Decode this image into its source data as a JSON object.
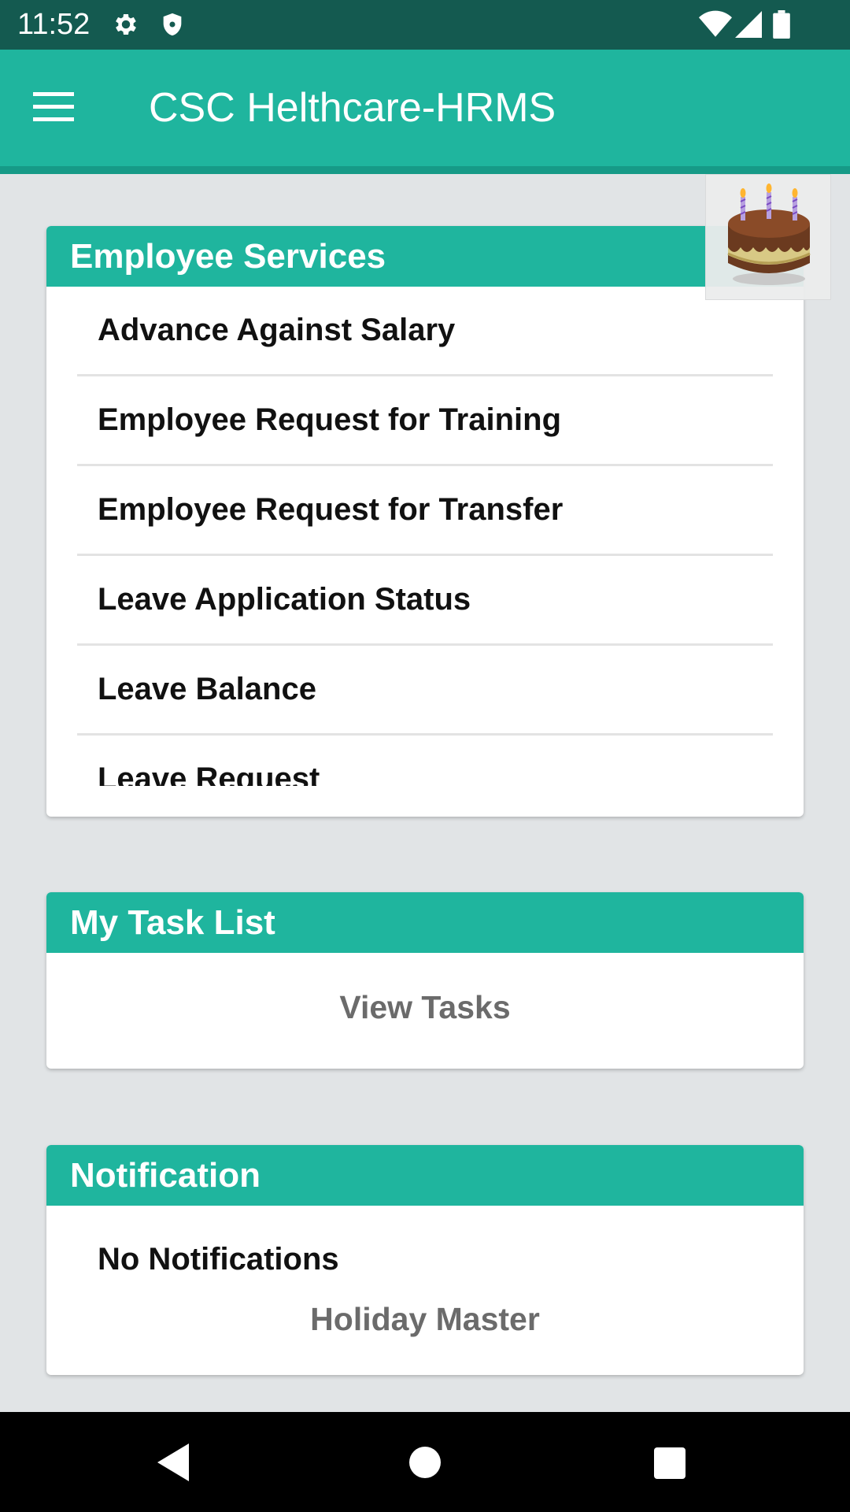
{
  "status_bar": {
    "time": "11:52",
    "icons": [
      "gear-icon",
      "shield-icon",
      "wifi-icon",
      "cell-signal-icon",
      "battery-icon"
    ]
  },
  "app_bar": {
    "title": "CSC Helthcare-HRMS",
    "menu_icon": "hamburger-menu-icon"
  },
  "employee_services": {
    "title": "Employee Services",
    "items": [
      {
        "label": "Advance Against Salary"
      },
      {
        "label": "Employee Request for Training"
      },
      {
        "label": "Employee Request for Transfer"
      },
      {
        "label": "Leave Application Status"
      },
      {
        "label": "Leave Balance"
      },
      {
        "label": "Leave Request"
      }
    ]
  },
  "task_list": {
    "title": "My Task List",
    "view_tasks_label": "View Tasks"
  },
  "notification": {
    "title": "Notification",
    "empty_text": "No Notifications",
    "holiday_master_label": "Holiday Master"
  },
  "birthday_icon": "birthday-cake-icon",
  "nav_bar": {
    "icons": [
      "back-icon",
      "home-icon",
      "recents-icon"
    ]
  },
  "colors": {
    "primary": "#1fb59e",
    "status_bar": "#145a50",
    "background": "#e1e4e6"
  }
}
